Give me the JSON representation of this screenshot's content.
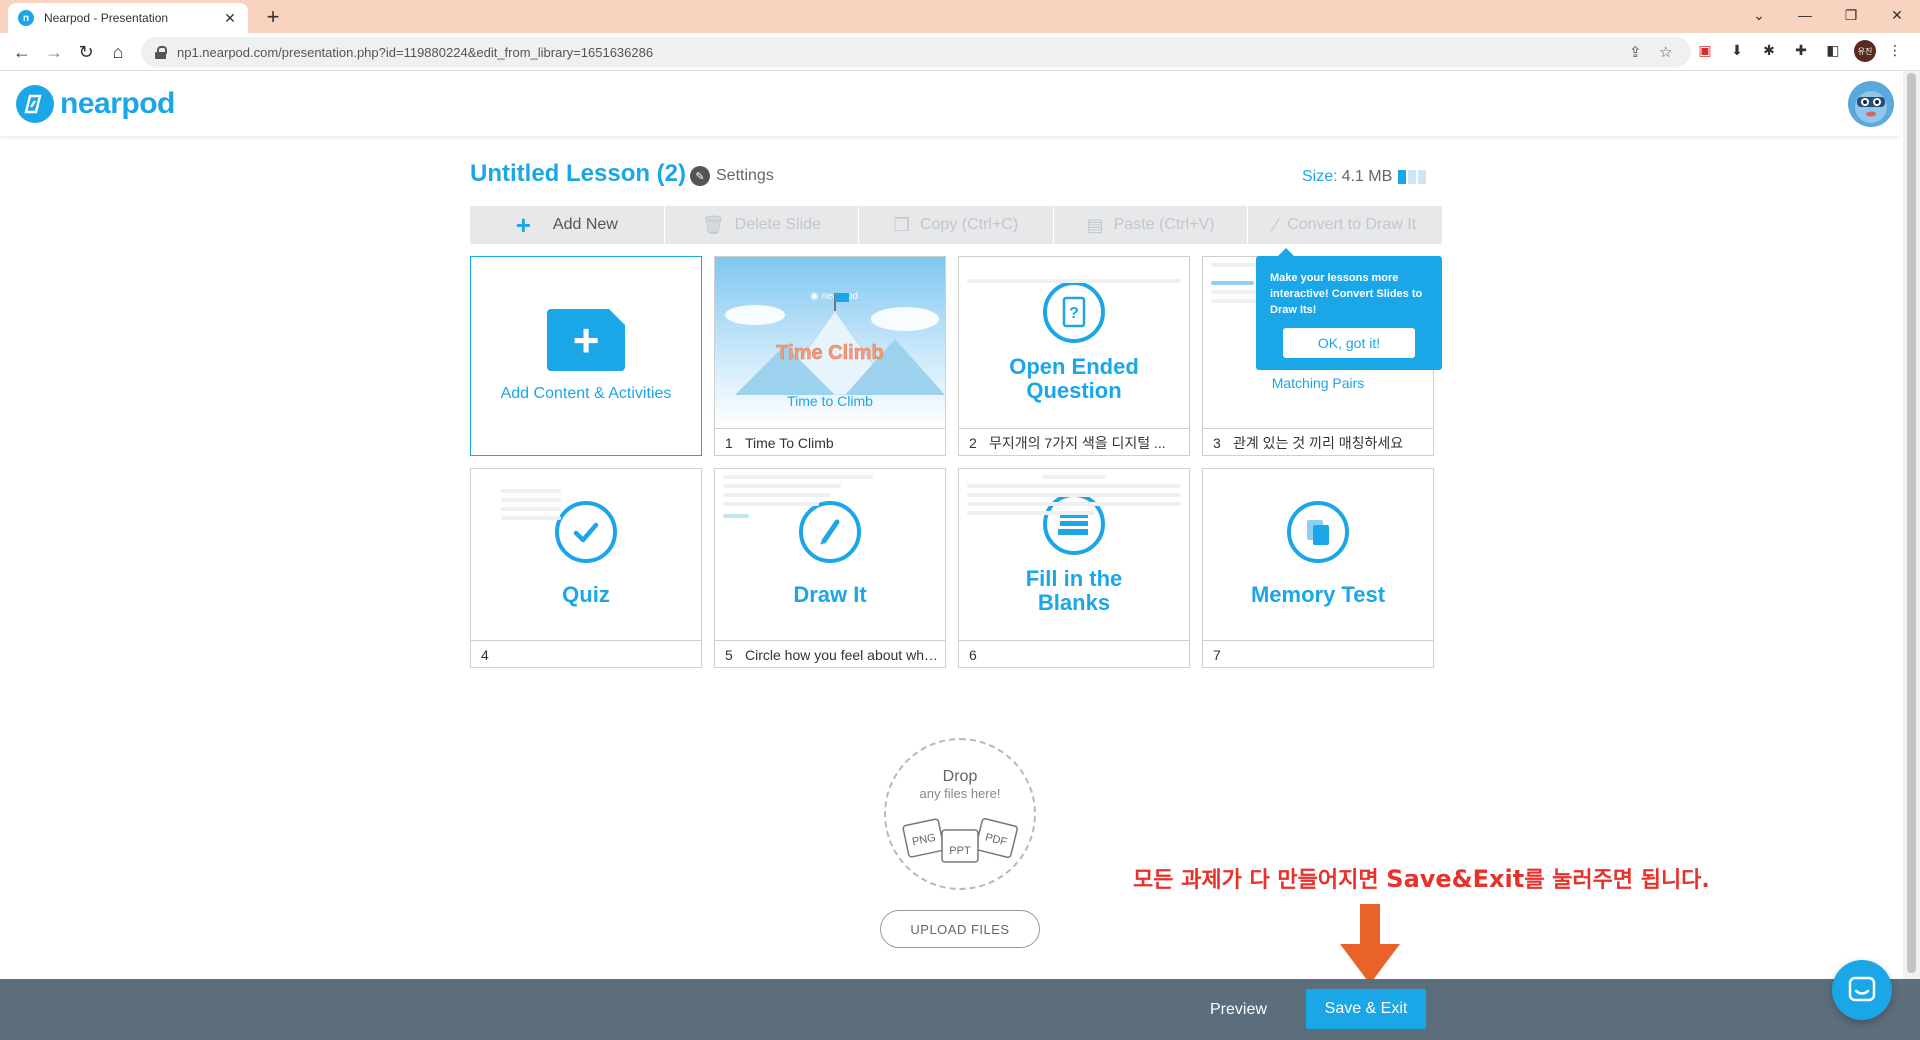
{
  "browser": {
    "tab_title": "Nearpod - Presentation",
    "url": "np1.nearpod.com/presentation.php?id=119880224&edit_from_library=1651636286",
    "profile_initials": "유진"
  },
  "header": {
    "logo_text": "nearpod"
  },
  "lesson": {
    "title": "Untitled Lesson (2)",
    "settings_label": "Settings",
    "size_label": "Size:",
    "size_value": "4.1 MB"
  },
  "actions": {
    "add_new": "Add New",
    "delete_slide": "Delete Slide",
    "copy": "Copy (Ctrl+C)",
    "paste": "Paste (Ctrl+V)",
    "convert": "Convert to Draw It"
  },
  "tooltip": {
    "text": "Make your lessons more interactive! Convert Slides to Draw Its!",
    "button": "OK, got it!"
  },
  "add_card": {
    "label": "Add Content & Activities"
  },
  "slides": [
    {
      "num": "1",
      "caption": "Time To Climb",
      "type_label": "Time to Climb",
      "art_text": "Time Climb"
    },
    {
      "num": "2",
      "caption": "무지개의 7가지 색을 디지털 ...",
      "type_label": "Open Ended Question"
    },
    {
      "num": "3",
      "caption": "관계 있는 것 끼리 매칭하세요",
      "type_label": "Matching Pairs"
    },
    {
      "num": "4",
      "caption": "",
      "type_label": "Quiz"
    },
    {
      "num": "5",
      "caption": "Circle how you feel about what yo...",
      "type_label": "Draw It"
    },
    {
      "num": "6",
      "caption": "",
      "type_label": "Fill in the Blanks"
    },
    {
      "num": "7",
      "caption": "",
      "type_label": "Memory Test"
    }
  ],
  "dropzone": {
    "title": "Drop",
    "subtitle": "any files here!",
    "file_types": [
      "PNG",
      "PPT",
      "PDF"
    ],
    "upload_label": "UPLOAD FILES"
  },
  "annotation": {
    "text_before": "모든 과제가 다 만들어지면 ",
    "text_bold": "Save&Exit",
    "text_after": "를 눌러주면 됩니다.",
    "color": "#e8312a"
  },
  "footer": {
    "preview": "Preview",
    "save_exit": "Save & Exit"
  },
  "colors": {
    "brand": "#1ba6e8",
    "footer_bg": "#5c6e7c"
  }
}
